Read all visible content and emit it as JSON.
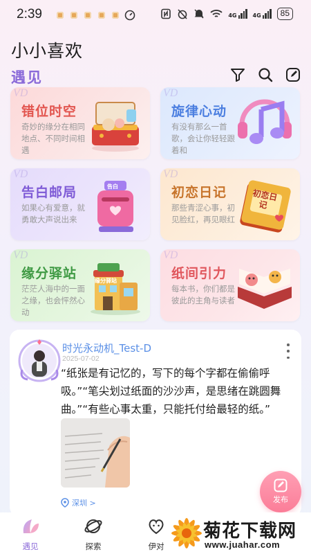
{
  "status_bar": {
    "time": "2:39",
    "battery": "85",
    "signal_1": "4G",
    "signal_2": "4G"
  },
  "header": {
    "app_title": "小小喜欢",
    "section_title": "遇见",
    "actions": [
      {
        "icon": "filter-icon"
      },
      {
        "icon": "search-icon"
      },
      {
        "icon": "edit-icon"
      }
    ]
  },
  "features": [
    {
      "title": "错位时空",
      "desc": "奇妙的缘分在相同地点、不同时间相遇",
      "theme": "pink",
      "watermark": "VD"
    },
    {
      "title": "旋律心动",
      "desc": "有没有那么一首歌，会让你轻轻跟着和",
      "theme": "blue",
      "watermark": "VD"
    },
    {
      "title": "告白邮局",
      "desc": "如果心有爱意，就勇敢大声说出来",
      "theme": "purple",
      "watermark": "VD"
    },
    {
      "title": "初恋日记",
      "desc": "那些青涩心事，初见脸红，再见眼红",
      "theme": "orange",
      "watermark": "VD"
    },
    {
      "title": "缘分驿站",
      "desc": "茫茫人海中的一面之缘，也会怦然心动",
      "theme": "green",
      "watermark": "VD"
    },
    {
      "title": "纸间引力",
      "desc": "每本书，你们都是彼此的主角与读者",
      "theme": "rose",
      "watermark": "VD"
    }
  ],
  "art_labels": {
    "mailbox": "告白",
    "diary": "初恋日记",
    "station": "缘分驿站"
  },
  "post": {
    "author": "时光永动机_Test-D",
    "date": "2025-07-02",
    "content": "“纸张是有记忆的，写下的每个字都在偷偷呼吸。”“笔尖划过纸面的沙沙声，是思绪在跳圆舞曲。”“有些心事太重，只能托付给最轻的纸。”",
    "location": "深圳 >"
  },
  "fab": {
    "label": "发布"
  },
  "nav": [
    {
      "label": "遇见",
      "active": true
    },
    {
      "label": "探索",
      "active": false
    },
    {
      "label": "伊对",
      "active": false
    }
  ],
  "watermark": {
    "title": "菊花下载网",
    "url": "www.juahar.com"
  },
  "colors": {
    "accent": "#8a6ad9",
    "link": "#5a8fe6",
    "fab": "#fb7d98"
  }
}
